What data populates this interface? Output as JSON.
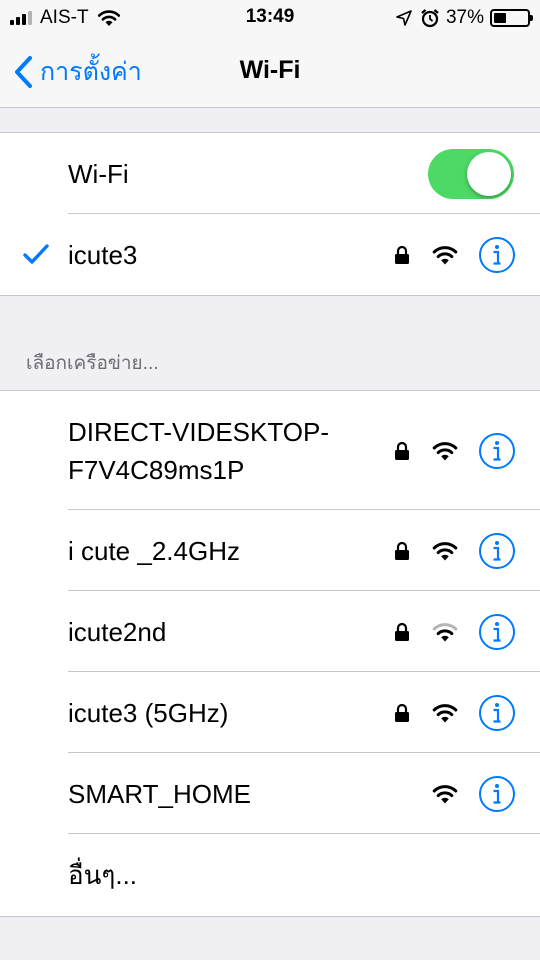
{
  "status_bar": {
    "carrier": "AIS-T",
    "time": "13:49",
    "battery_percent": "37%",
    "battery_level": 0.37,
    "signal_bars": 3
  },
  "nav": {
    "back_label": "การตั้งค่า",
    "title": "Wi-Fi"
  },
  "wifi_toggle": {
    "label": "Wi-Fi",
    "on": true,
    "color": "#4cd964"
  },
  "connected": {
    "name": "icute3",
    "secured": true
  },
  "section_header": "เลือกเครือข่าย...",
  "networks": [
    {
      "name_line1": "DIRECT-VIDESKTOP-",
      "name_line2": "F7V4C89ms1P",
      "secured": true,
      "strength": "full"
    },
    {
      "name": "i cute _2.4GHz",
      "secured": true,
      "strength": "full"
    },
    {
      "name": "icute2nd",
      "secured": true,
      "strength": "weak"
    },
    {
      "name": "icute3 (5GHz)",
      "secured": true,
      "strength": "full"
    },
    {
      "name": "SMART_HOME",
      "secured": false,
      "strength": "full"
    }
  ],
  "other_label": "อื่นๆ...",
  "colors": {
    "accent": "#007aff",
    "background": "#efeff4",
    "separator": "#c8c7cc"
  }
}
